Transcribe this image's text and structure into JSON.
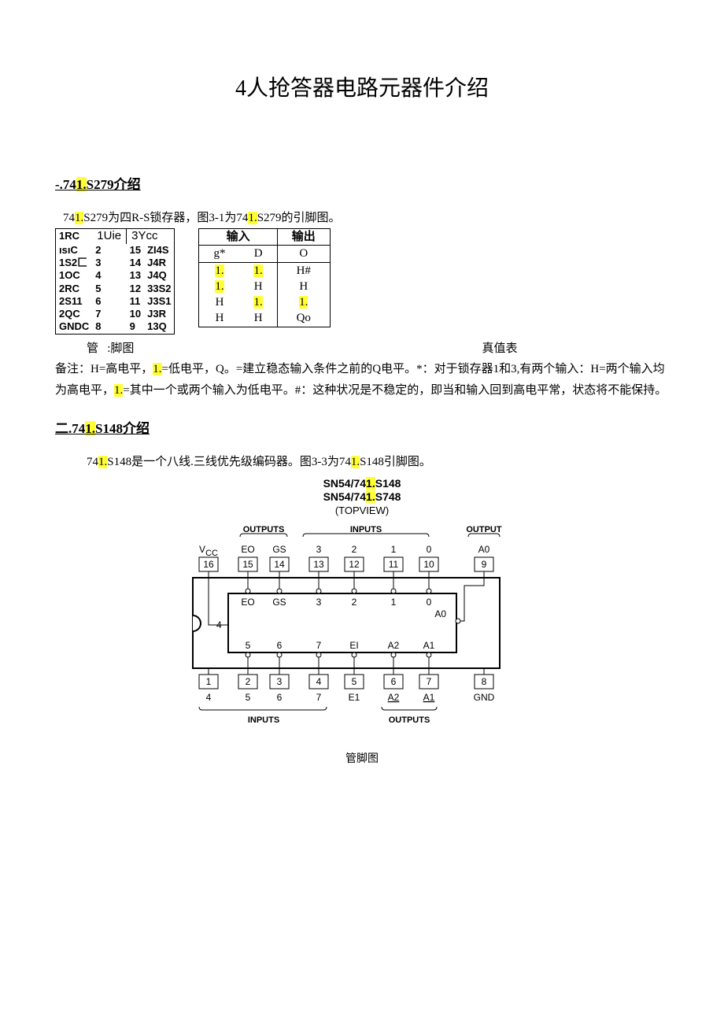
{
  "title": "4人抢答器电路元器件介绍",
  "s1": {
    "head_pre": "-.74",
    "head_hl": "1.",
    "head_post": "S279介绍",
    "intro_a": "74",
    "intro_b": "1.",
    "intro_c": "S279为四R-S锁存器，图3-1为74",
    "intro_d": "1.",
    "intro_e": "S279的引脚图。",
    "pins": {
      "r1": {
        "l1": "1RC",
        "c1": "1Uie",
        "c2": "3Ycc"
      },
      "r2": {
        "l1": "ısıC",
        "n1": "2",
        "n2": "15",
        "r": "ZI4S"
      },
      "r3": {
        "l1": "1S2匚",
        "n1": "3",
        "n2": "14",
        "r": "J4R"
      },
      "r4": {
        "l1": "1OC",
        "n1": "4",
        "n2": "13",
        "r": "J4Q"
      },
      "r5": {
        "l1": "2RC",
        "n1": "5",
        "n2": "12",
        "r": "33S2"
      },
      "r6": {
        "l1": "2S11",
        "n1": "6",
        "n2": "11",
        "r": "J3S1"
      },
      "r7": {
        "l1": "2QC",
        "n1": "7",
        "n2": "10",
        "r": "J3R"
      },
      "r8": {
        "l1": "GNDC",
        "n1": "8",
        "n2": "9",
        "r": "13Q"
      }
    },
    "truth": {
      "h_in": "输入",
      "h_out": "输出",
      "h1": "g*",
      "h2": "D",
      "h3": "O",
      "r1": {
        "a": "1.",
        "b": "1.",
        "c": "H#"
      },
      "r2": {
        "a": "1.",
        "b": "H",
        "c": "H"
      },
      "r3": {
        "a": "H",
        "b": "1.",
        "c": "1."
      },
      "r4": {
        "a": "H",
        "b": "H",
        "c": "Qo"
      }
    },
    "cap_left_a": "管",
    "cap_left_b": ":脚图",
    "cap_right": "真值表",
    "note_a": "备注：H=高电平，",
    "note_b": "1.",
    "note_c": "=低电平，Q。=建立稳态输入条件之前的Q电平。*：对于锁存器1和3,有两个输入：H=两个输入均为高电平，",
    "note_d": "1.",
    "note_e": "=其中一个或两个输入为低电平。#：这种状况是不稳定的，即当和输入回到高电平常，状态将不能保持。"
  },
  "s2": {
    "head_pre": "二.74",
    "head_hl": "1.",
    "head_post": "S148介绍",
    "intro_a": "74",
    "intro_b": "1.",
    "intro_c": "S148是一个八线.三线优先级编码器。图3-3为74",
    "intro_d": "1.",
    "intro_e": "S148引脚图。",
    "chip_t1a": "SN54/74",
    "chip_t1b": "1.",
    "chip_t1c": "S148",
    "chip_t2a": "SN54/74",
    "chip_t2b": "1.",
    "chip_t2c": "S748",
    "chip_sub": "(TOPVIEW)",
    "lbl_outputs": "OUTPUTS",
    "lbl_inputs": "INPUTS",
    "lbl_output": "OUTPUT",
    "top": {
      "vcc": "V",
      "cc": "CC",
      "eo": "EO",
      "gs": "GS",
      "p3": "3",
      "p2": "2",
      "p1": "1",
      "p0": "0",
      "a0": "A0"
    },
    "topnums": [
      "16",
      "15",
      "14",
      "13",
      "12",
      "11",
      "10",
      "9"
    ],
    "mid_top": [
      "EO",
      "GS",
      "3",
      "2",
      "1",
      "0"
    ],
    "mid_left": "4",
    "mid_right": "A0",
    "mid_bot": [
      "5",
      "6",
      "7",
      "EI",
      "A2",
      "A1"
    ],
    "botnums": [
      "1",
      "2",
      "3",
      "4",
      "5",
      "6",
      "7",
      "8"
    ],
    "bot": {
      "p4": "4",
      "p5": "5",
      "p6": "6",
      "p7": "7",
      "e1": "E1",
      "a2": "A2",
      "a1": "A1",
      "gnd": "GND"
    },
    "caption": "管脚图"
  }
}
